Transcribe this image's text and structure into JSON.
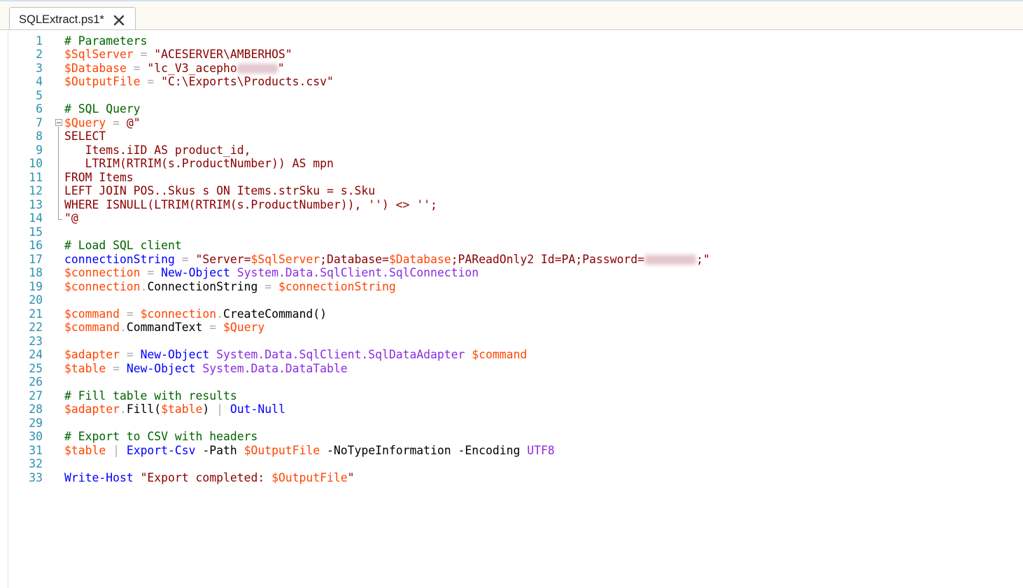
{
  "tab": {
    "title": "SQLExtract.ps1*"
  },
  "colors": {
    "comment": "#006400",
    "variable": "#ff4500",
    "string": "#8b0000",
    "operator": "#a9a9a9",
    "command": "#0000ff",
    "type": "#8a2be2",
    "line_number": "#2b91af"
  },
  "lines": [
    {
      "n": "1",
      "tokens": [
        {
          "t": "# Parameters",
          "c": "com"
        }
      ]
    },
    {
      "n": "2",
      "tokens": [
        {
          "t": "$SqlServer",
          "c": "var"
        },
        {
          "t": " = ",
          "c": "op"
        },
        {
          "t": "\"ACESERVER\\AMBERHOS\"",
          "c": "str"
        }
      ]
    },
    {
      "n": "3",
      "tokens": [
        {
          "t": "$Database",
          "c": "var"
        },
        {
          "t": " = ",
          "c": "op"
        },
        {
          "t": "\"lc_V3_acepho",
          "c": "str"
        },
        {
          "t": "",
          "c": "blur",
          "w": 58
        },
        {
          "t": "\"",
          "c": "str"
        }
      ]
    },
    {
      "n": "4",
      "tokens": [
        {
          "t": "$OutputFile",
          "c": "var"
        },
        {
          "t": " = ",
          "c": "op"
        },
        {
          "t": "\"C:\\Exports\\Products.csv\"",
          "c": "str"
        }
      ]
    },
    {
      "n": "5",
      "tokens": []
    },
    {
      "n": "6",
      "tokens": [
        {
          "t": "# SQL Query",
          "c": "com"
        }
      ]
    },
    {
      "n": "7",
      "fold": "start",
      "tokens": [
        {
          "t": "$Query",
          "c": "var"
        },
        {
          "t": " = ",
          "c": "op"
        },
        {
          "t": "@\"",
          "c": "str"
        }
      ]
    },
    {
      "n": "8",
      "tokens": [
        {
          "t": "SELECT",
          "c": "str"
        }
      ]
    },
    {
      "n": "9",
      "tokens": [
        {
          "t": "   Items.iID AS product_id,",
          "c": "str"
        }
      ]
    },
    {
      "n": "10",
      "tokens": [
        {
          "t": "   LTRIM(RTRIM(s.ProductNumber)) AS mpn",
          "c": "str"
        }
      ]
    },
    {
      "n": "11",
      "tokens": [
        {
          "t": "FROM Items",
          "c": "str"
        }
      ]
    },
    {
      "n": "12",
      "tokens": [
        {
          "t": "LEFT JOIN POS..Skus s ON Items.strSku = s.Sku",
          "c": "str"
        }
      ]
    },
    {
      "n": "13",
      "tokens": [
        {
          "t": "WHERE ISNULL(LTRIM(RTRIM(s.ProductNumber)), '') <> '';",
          "c": "str"
        }
      ]
    },
    {
      "n": "14",
      "fold": "end",
      "tokens": [
        {
          "t": "\"@",
          "c": "str"
        }
      ]
    },
    {
      "n": "15",
      "tokens": []
    },
    {
      "n": "16",
      "tokens": [
        {
          "t": "# Load SQL client",
          "c": "com"
        }
      ]
    },
    {
      "n": "17",
      "tokens": [
        {
          "t": "connectionString",
          "c": "cmd"
        },
        {
          "t": " = ",
          "c": "op"
        },
        {
          "t": "\"Server=",
          "c": "str"
        },
        {
          "t": "$SqlServer",
          "c": "var"
        },
        {
          "t": ";Database=",
          "c": "str"
        },
        {
          "t": "$Database",
          "c": "var"
        },
        {
          "t": ";PAReadOnly2 Id=PA;Password=",
          "c": "str"
        },
        {
          "t": "",
          "c": "blur",
          "w": 74
        },
        {
          "t": ";\"",
          "c": "str"
        }
      ]
    },
    {
      "n": "18",
      "tokens": [
        {
          "t": "$connection",
          "c": "var"
        },
        {
          "t": " = ",
          "c": "op"
        },
        {
          "t": "New-Object",
          "c": "cmd"
        },
        {
          "t": " ",
          "c": "plain"
        },
        {
          "t": "System.Data.SqlClient.SqlConnection",
          "c": "type"
        }
      ]
    },
    {
      "n": "19",
      "tokens": [
        {
          "t": "$connection",
          "c": "var"
        },
        {
          "t": ".",
          "c": "op"
        },
        {
          "t": "ConnectionString",
          "c": "mem"
        },
        {
          "t": " = ",
          "c": "op"
        },
        {
          "t": "$connectionString",
          "c": "var"
        }
      ]
    },
    {
      "n": "20",
      "tokens": []
    },
    {
      "n": "21",
      "tokens": [
        {
          "t": "$command",
          "c": "var"
        },
        {
          "t": " = ",
          "c": "op"
        },
        {
          "t": "$connection",
          "c": "var"
        },
        {
          "t": ".",
          "c": "op"
        },
        {
          "t": "CreateCommand()",
          "c": "mem"
        }
      ]
    },
    {
      "n": "22",
      "tokens": [
        {
          "t": "$command",
          "c": "var"
        },
        {
          "t": ".",
          "c": "op"
        },
        {
          "t": "CommandText",
          "c": "mem"
        },
        {
          "t": " = ",
          "c": "op"
        },
        {
          "t": "$Query",
          "c": "var"
        }
      ]
    },
    {
      "n": "23",
      "tokens": []
    },
    {
      "n": "24",
      "tokens": [
        {
          "t": "$adapter",
          "c": "var"
        },
        {
          "t": " = ",
          "c": "op"
        },
        {
          "t": "New-Object",
          "c": "cmd"
        },
        {
          "t": " ",
          "c": "plain"
        },
        {
          "t": "System.Data.SqlClient.SqlDataAdapter",
          "c": "type"
        },
        {
          "t": " ",
          "c": "plain"
        },
        {
          "t": "$command",
          "c": "var"
        }
      ]
    },
    {
      "n": "25",
      "tokens": [
        {
          "t": "$table",
          "c": "var"
        },
        {
          "t": " = ",
          "c": "op"
        },
        {
          "t": "New-Object",
          "c": "cmd"
        },
        {
          "t": " ",
          "c": "plain"
        },
        {
          "t": "System.Data.DataTable",
          "c": "type"
        }
      ]
    },
    {
      "n": "26",
      "tokens": []
    },
    {
      "n": "27",
      "tokens": [
        {
          "t": "# Fill table with results",
          "c": "com"
        }
      ]
    },
    {
      "n": "28",
      "tokens": [
        {
          "t": "$adapter",
          "c": "var"
        },
        {
          "t": ".",
          "c": "op"
        },
        {
          "t": "Fill(",
          "c": "mem"
        },
        {
          "t": "$table",
          "c": "var"
        },
        {
          "t": ")",
          "c": "mem"
        },
        {
          "t": " | ",
          "c": "op"
        },
        {
          "t": "Out-Null",
          "c": "cmd"
        }
      ]
    },
    {
      "n": "29",
      "tokens": []
    },
    {
      "n": "30",
      "tokens": [
        {
          "t": "# Export to CSV with headers",
          "c": "com"
        }
      ]
    },
    {
      "n": "31",
      "tokens": [
        {
          "t": "$table",
          "c": "var"
        },
        {
          "t": " | ",
          "c": "op"
        },
        {
          "t": "Export-Csv",
          "c": "cmd"
        },
        {
          "t": " -Path ",
          "c": "plain"
        },
        {
          "t": "$OutputFile",
          "c": "var"
        },
        {
          "t": " -NoTypeInformation -Encoding ",
          "c": "plain"
        },
        {
          "t": "UTF8",
          "c": "type"
        }
      ]
    },
    {
      "n": "32",
      "tokens": []
    },
    {
      "n": "33",
      "tokens": [
        {
          "t": "Write-Host",
          "c": "cmd"
        },
        {
          "t": " ",
          "c": "plain"
        },
        {
          "t": "\"Export completed: ",
          "c": "str"
        },
        {
          "t": "$OutputFile",
          "c": "var"
        },
        {
          "t": "\"",
          "c": "str"
        }
      ]
    }
  ]
}
